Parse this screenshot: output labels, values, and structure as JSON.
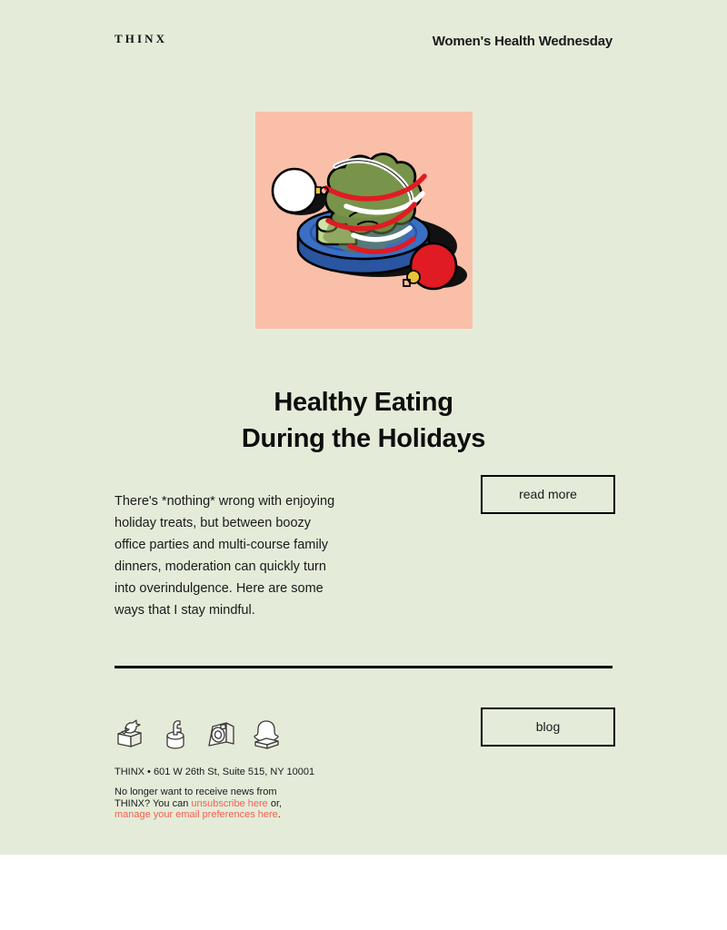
{
  "header": {
    "logo": "THINX",
    "tagline": "Women's Health Wednesday"
  },
  "hero": {
    "alt_name": "broccoli-wrapped-in-ribbon-on-blue-plate",
    "background_color": "#f9bfa9",
    "colors": {
      "broccoli_body": "#78934a",
      "broccoli_body_shade": "#6b8440",
      "broccoli_stalk": "#bcd68a",
      "plate_top": "#3a6fc4",
      "plate_side": "#2a55a0",
      "ribbon_red": "#e01b24",
      "ribbon_white": "#ffffff",
      "ornament_red": "#e01b24",
      "ornament_white": "#ffffff",
      "ornament_cap": "#e8c33a",
      "outline": "#000000",
      "shadow": "#111111"
    }
  },
  "article": {
    "title_line_1": "Healthy Eating",
    "title_line_2": "During the Holidays",
    "body": "There's *nothing* wrong with enjoying holiday treats, but between boozy office parties and multi-course family dinners, moderation can quickly turn into overindulgence. Here are some ways that I stay mindful.",
    "read_more_label": "read more"
  },
  "footer": {
    "blog_label": "blog",
    "social": [
      {
        "name": "twitter-icon",
        "label": "Twitter"
      },
      {
        "name": "facebook-icon",
        "label": "Facebook"
      },
      {
        "name": "instagram-icon",
        "label": "Instagram"
      },
      {
        "name": "snapchat-icon",
        "label": "Snapchat"
      }
    ],
    "address": "THINX • 601 W 26th St, Suite 515, NY 10001",
    "unsubscribe": {
      "text_before": "No longer want to receive news from THINX? You can ",
      "link_1": "unsubscribe here",
      "text_middle": " or, ",
      "link_2": "manage your email preferences here",
      "text_after": "."
    },
    "link_color": "#f4604e"
  },
  "page": {
    "background_color": "#e4ecd9",
    "outer_background_color": "#ffffff"
  }
}
